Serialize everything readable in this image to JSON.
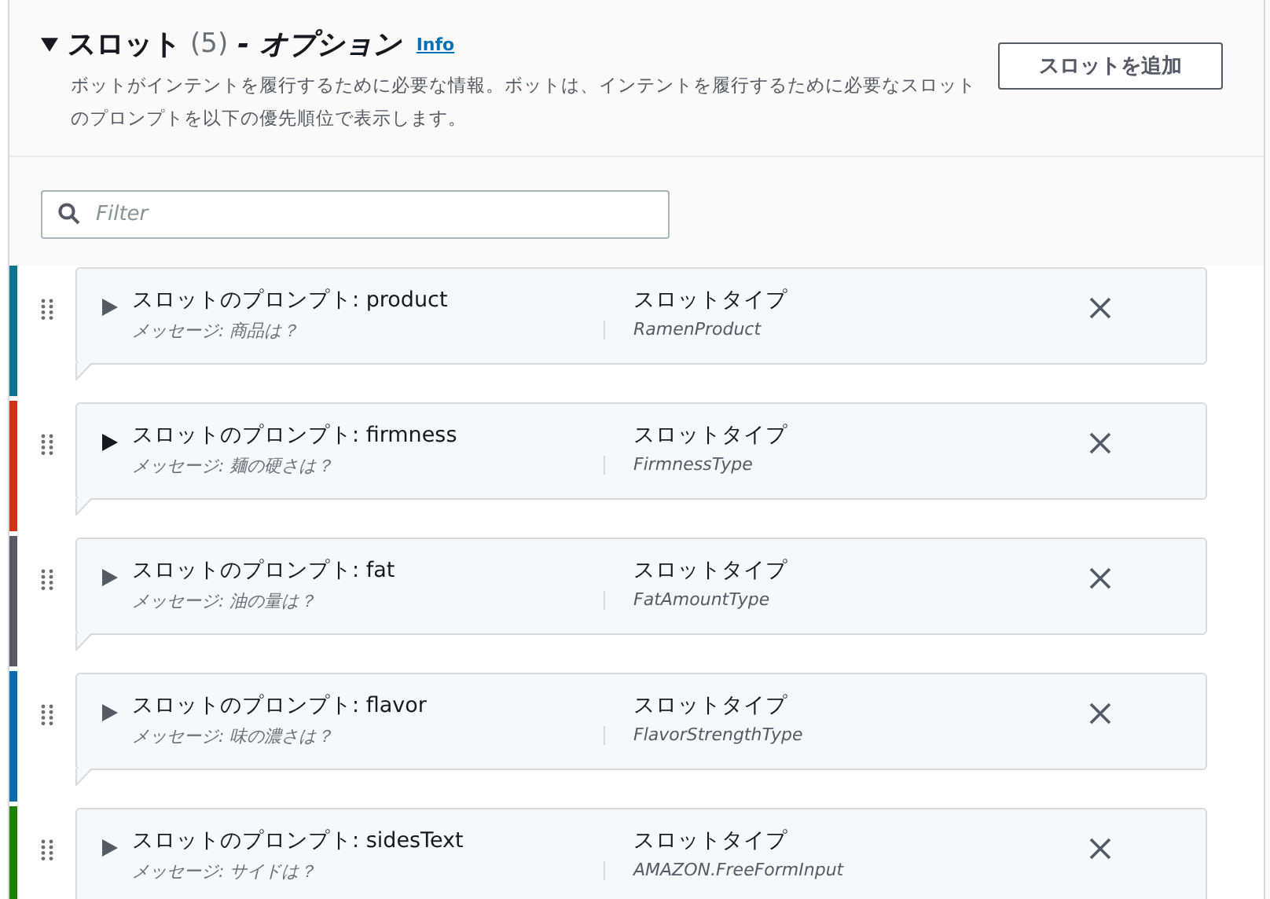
{
  "section": {
    "expanded": true,
    "title": "スロット",
    "count": "(5)",
    "suffix": "- オプション",
    "info": "Info",
    "description": "ボットがインテントを履行するために必要な情報。ボットは、インテントを履行するために必要なスロットのプロンプトを以下の優先順位で表示します。",
    "add_button": "スロットを追加"
  },
  "filter": {
    "placeholder": "Filter"
  },
  "slots": [
    {
      "prompt": "スロットのプロンプト: product",
      "message": "メッセージ: 商品は？",
      "type_label": "スロットタイプ",
      "type": "RamenProduct",
      "color": "#0f7490",
      "highlighted": false
    },
    {
      "prompt": "スロットのプロンプト: firmness",
      "message": "メッセージ: 麺の硬さは？",
      "type_label": "スロットタイプ",
      "type": "FirmnessType",
      "color": "#d13212",
      "highlighted": true
    },
    {
      "prompt": "スロットのプロンプト: fat",
      "message": "メッセージ: 油の量は？",
      "type_label": "スロットタイプ",
      "type": "FatAmountType",
      "color": "#545b64",
      "highlighted": false
    },
    {
      "prompt": "スロットのプロンプト: flavor",
      "message": "メッセージ: 味の濃さは？",
      "type_label": "スロットタイプ",
      "type": "FlavorStrengthType",
      "color": "#0b6cb0",
      "highlighted": false
    },
    {
      "prompt": "スロットのプロンプト: sidesText",
      "message": "メッセージ: サイドは？",
      "type_label": "スロットタイプ",
      "type": "AMAZON.FreeFormInput",
      "color": "#1d8102",
      "highlighted": false
    }
  ]
}
